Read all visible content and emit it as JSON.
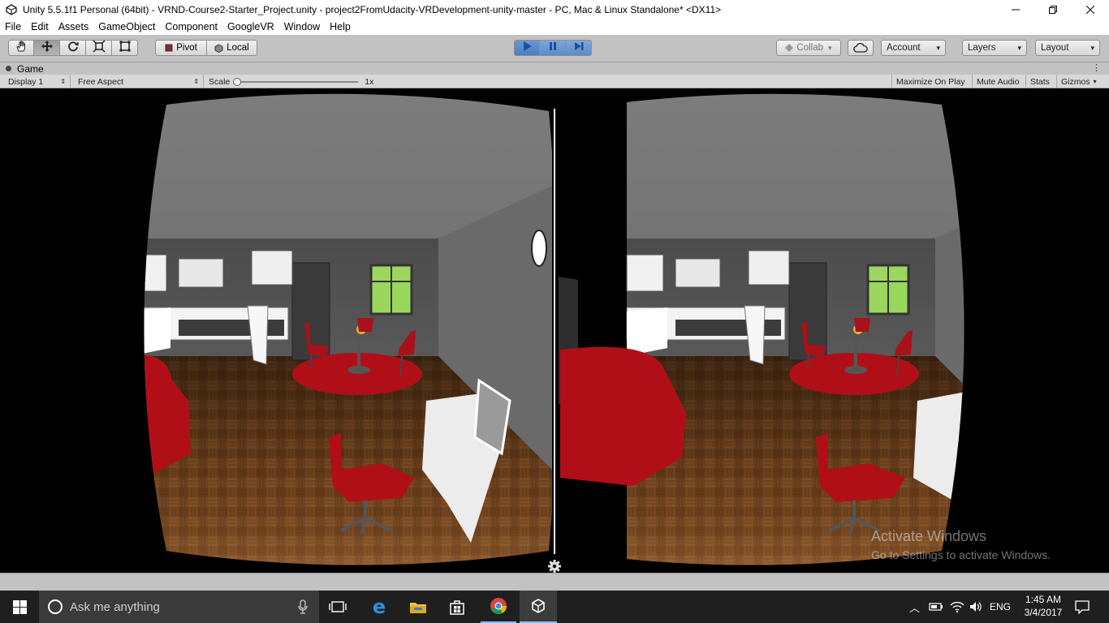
{
  "window": {
    "title": "Unity 5.5.1f1 Personal (64bit) - VRND-Course2-Starter_Project.unity - project2FromUdacity-VRDevelopment-unity-master - PC, Mac & Linux Standalone* <DX11>"
  },
  "menu": [
    "File",
    "Edit",
    "Assets",
    "GameObject",
    "Component",
    "GoogleVR",
    "Window",
    "Help"
  ],
  "toolbar": {
    "tools": [
      "hand-icon",
      "move-icon",
      "rotate-icon",
      "scale-icon",
      "rect-icon"
    ],
    "pivot_label": "Pivot",
    "local_label": "Local",
    "playback": [
      "play-icon",
      "pause-icon",
      "step-icon"
    ],
    "collab_label": "Collab",
    "account_label": "Account",
    "layers_label": "Layers",
    "layout_label": "Layout"
  },
  "game_tab": {
    "label": "Game"
  },
  "game_bar": {
    "display": "Display 1",
    "aspect": "Free Aspect",
    "scale_label": "Scale",
    "scale_value": "1x",
    "scale_level": 0.0,
    "maximize": "Maximize On Play",
    "mute": "Mute Audio",
    "stats": "Stats",
    "gizmos": "Gizmos"
  },
  "watermark": {
    "line1": "Activate Windows",
    "line2": "Go to Settings to activate Windows."
  },
  "taskbar": {
    "search_placeholder": "Ask me anything",
    "lang": "ENG",
    "time": "1:45 AM",
    "date": "3/4/2017"
  },
  "colors": {
    "toolbar_bg": "#c2c2c2",
    "play_active": "#5d8bc4",
    "floor": "#7a4a22",
    "wall": "#5a5a5a",
    "accent_red": "#b10f17",
    "taskbar": "#1f1f1f"
  }
}
